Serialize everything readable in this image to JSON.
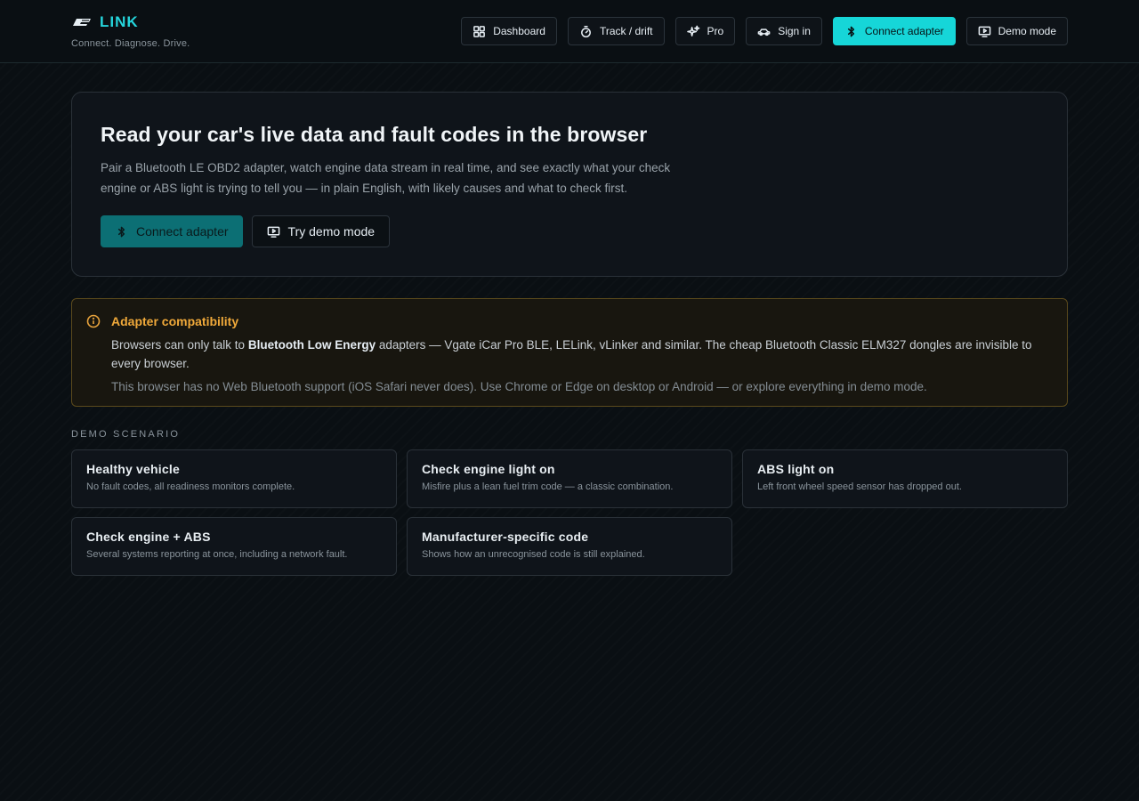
{
  "brand": {
    "name": "LINK",
    "tagline": "Connect. Diagnose. Drive."
  },
  "nav": {
    "dashboard": "Dashboard",
    "track": "Track / drift",
    "pro": "Pro",
    "signin": "Sign in",
    "connect": "Connect adapter",
    "demo": "Demo mode"
  },
  "hero": {
    "title": "Read your car's live data and fault codes in the browser",
    "description": "Pair a Bluetooth LE OBD2 adapter, watch engine data stream in real time, and see exactly what your check engine or ABS light is trying to tell you — in plain English, with likely causes and what to check first.",
    "connect_label": "Connect adapter",
    "demo_label": "Try demo mode"
  },
  "notice": {
    "title": "Adapter compatibility",
    "body_pre": "Browsers can only talk to ",
    "body_bold": "Bluetooth Low Energy",
    "body_post": " adapters — Vgate iCar Pro BLE, LELink, vLinker and similar. The cheap Bluetooth Classic ELM327 dongles are invisible to every browser.",
    "foot": "This browser has no Web Bluetooth support (iOS Safari never does). Use Chrome or Edge on desktop or Android — or explore everything in demo mode."
  },
  "scenarios": {
    "label": "DEMO SCENARIO",
    "items": [
      {
        "title": "Healthy vehicle",
        "desc": "No fault codes, all readiness monitors complete."
      },
      {
        "title": "Check engine light on",
        "desc": "Misfire plus a lean fuel trim code — a classic combination."
      },
      {
        "title": "ABS light on",
        "desc": "Left front wheel speed sensor has dropped out."
      },
      {
        "title": "Check engine + ABS",
        "desc": "Several systems reporting at once, including a network fault."
      },
      {
        "title": "Manufacturer-specific code",
        "desc": "Shows how an unrecognised code is still explained."
      }
    ]
  },
  "colors": {
    "accent": "#16d6d8",
    "warning": "#f0a93a",
    "background": "#0a0f13"
  }
}
